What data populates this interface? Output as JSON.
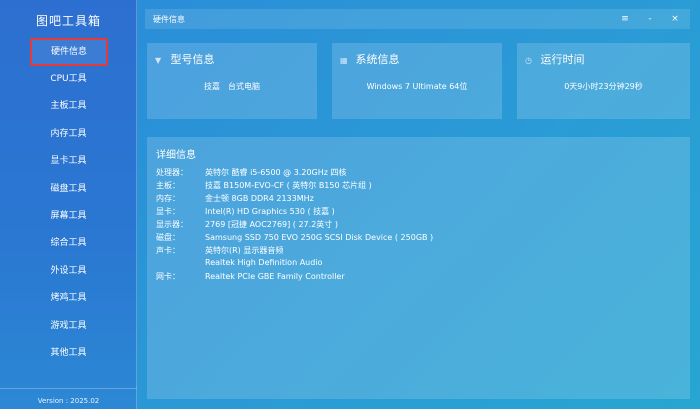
{
  "app": {
    "title": "图吧工具箱",
    "version": "Version : 2025.02"
  },
  "sidebar": {
    "items": [
      {
        "label": "硬件信息"
      },
      {
        "label": "CPU工具"
      },
      {
        "label": "主板工具"
      },
      {
        "label": "内存工具"
      },
      {
        "label": "显卡工具"
      },
      {
        "label": "磁盘工具"
      },
      {
        "label": "屏幕工具"
      },
      {
        "label": "综合工具"
      },
      {
        "label": "外设工具"
      },
      {
        "label": "烤鸡工具"
      },
      {
        "label": "游戏工具"
      },
      {
        "label": "其他工具"
      }
    ]
  },
  "window": {
    "title": "硬件信息",
    "menu": "≡",
    "minimize": "-",
    "close": "×"
  },
  "cards": {
    "model": {
      "title": "型号信息",
      "value": "技嘉　台式电脑"
    },
    "system": {
      "title": "系统信息",
      "value": "Windows 7 Ultimate 64位"
    },
    "uptime": {
      "title": "运行时间",
      "value": "0天9小时23分钟29秒"
    }
  },
  "detail": {
    "title": "详细信息",
    "rows": [
      {
        "label": "处理器：",
        "value": "英特尔 酷睿 i5-6500 @ 3.20GHz 四核"
      },
      {
        "label": "主板：",
        "value": "技嘉 B150M-EVO-CF ( 英特尔 B150 芯片组 )"
      },
      {
        "label": "内存：",
        "value": "金士顿 8GB DDR4 2133MHz"
      },
      {
        "label": "显卡：",
        "value": "Intel(R) HD Graphics 530 ( 技嘉 )"
      },
      {
        "label": "显示器：",
        "value": "2769 [冠捷 AOC2769] ( 27.2英寸 )"
      },
      {
        "label": "磁盘：",
        "value": "Samsung SSD 750 EVO 250G SCSI Disk Device ( 250GB )"
      },
      {
        "label": "声卡：",
        "value": "英特尔(R) 显示器音频"
      },
      {
        "label": "",
        "value": "Realtek High Definition Audio"
      },
      {
        "label": "网卡：",
        "value": "Realtek PCIe GBE Family Controller"
      }
    ]
  }
}
